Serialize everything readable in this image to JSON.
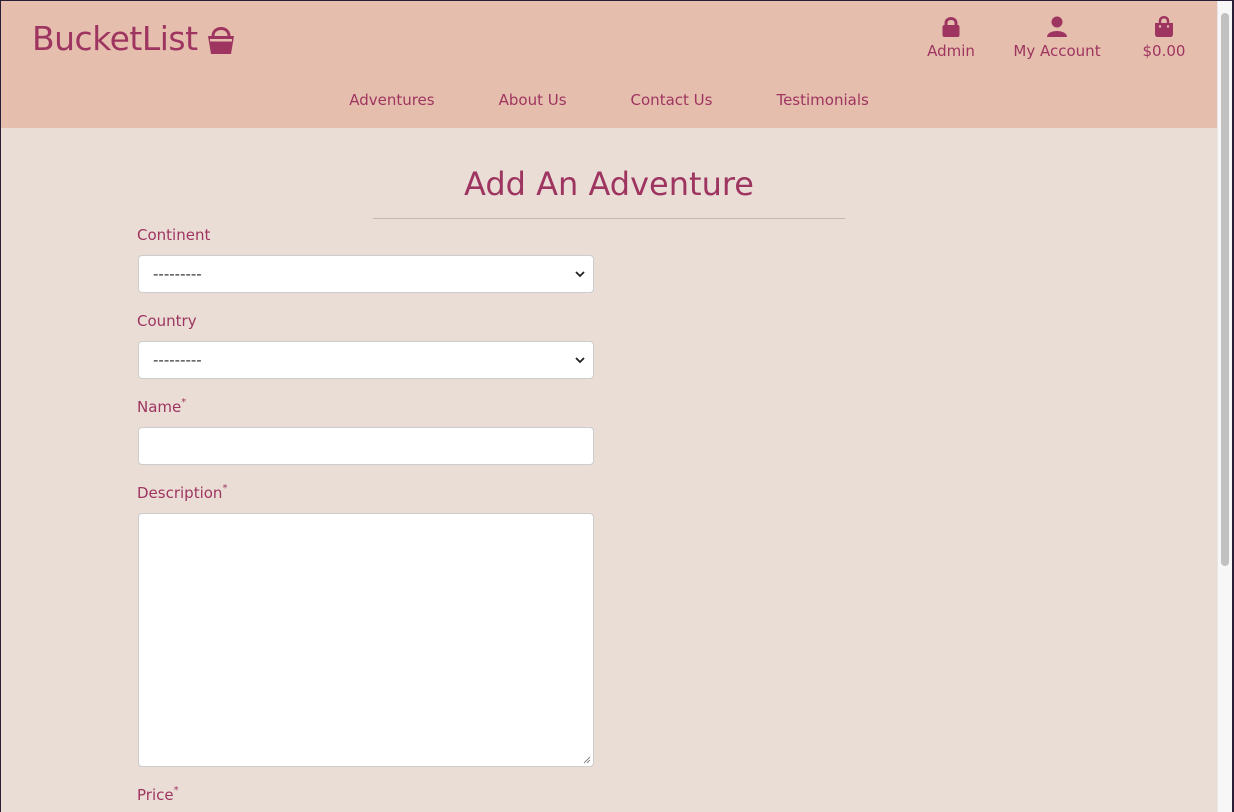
{
  "brand": {
    "name": "BucketList",
    "icon": "basket-icon",
    "color": "#9e3560"
  },
  "top_nav": {
    "admin": {
      "label": "Admin",
      "icon": "lock-icon"
    },
    "account": {
      "label": "My Account",
      "icon": "user-icon"
    },
    "bag": {
      "label": "$0.00",
      "icon": "shopping-bag-icon"
    }
  },
  "main_nav": {
    "adventures": "Adventures",
    "about": "About Us",
    "contact": "Contact Us",
    "testimonials": "Testimonials"
  },
  "page": {
    "title": "Add An Adventure"
  },
  "form": {
    "continent": {
      "label": "Continent",
      "value": "---------"
    },
    "country": {
      "label": "Country",
      "value": "---------"
    },
    "name": {
      "label": "Name",
      "required": "*",
      "value": ""
    },
    "description": {
      "label": "Description",
      "required": "*",
      "value": ""
    },
    "price": {
      "label": "Price",
      "required": "*"
    }
  },
  "colors": {
    "header_bg": "#e6beae",
    "page_bg": "#eaddd6",
    "accent": "#9e3560"
  }
}
